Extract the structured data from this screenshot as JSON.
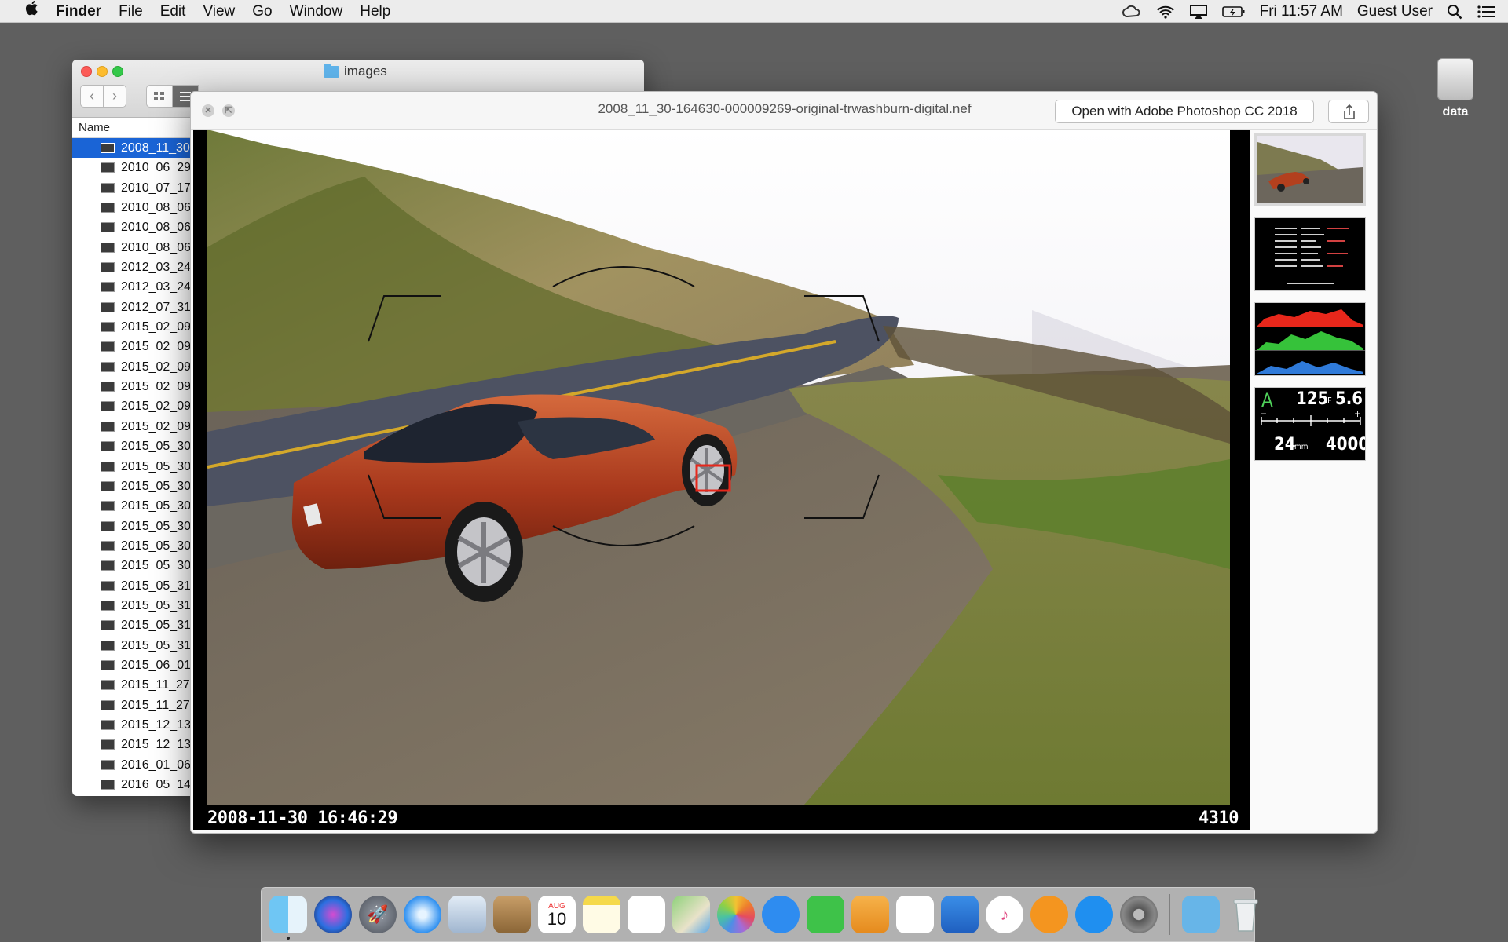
{
  "menubar": {
    "apple": "",
    "app_name": "Finder",
    "menus": [
      "File",
      "Edit",
      "View",
      "Go",
      "Window",
      "Help"
    ],
    "clock": "Fri 11:57 AM",
    "user": "Guest User"
  },
  "desktop": {
    "drive_label": "data"
  },
  "finder": {
    "title": "images",
    "column_header": "Name",
    "files": [
      "2008_11_30",
      "2010_06_29",
      "2010_07_17-",
      "2010_08_06",
      "2010_08_06",
      "2010_08_06",
      "2012_03_24",
      "2012_03_24",
      "2012_07_31-",
      "2015_02_09",
      "2015_02_09",
      "2015_02_09",
      "2015_02_09",
      "2015_02_09",
      "2015_02_09",
      "2015_05_30",
      "2015_05_30",
      "2015_05_30",
      "2015_05_30",
      "2015_05_30",
      "2015_05_30",
      "2015_05_30",
      "2015_05_31",
      "2015_05_31",
      "2015_05_31",
      "2015_05_31",
      "2015_06_01",
      "2015_11_27-",
      "2015_11_27-",
      "2015_12_13-",
      "2015_12_13-",
      "2016_01_06",
      "2016_05_14"
    ],
    "selected_index": 0
  },
  "quicklook": {
    "filename": "2008_11_30-164630-000009269-original-trwashburn-digital.nef",
    "open_with_label": "Open with Adobe Photoshop CC 2018",
    "timestamp": "2008-11-30 16:46:29",
    "frame_number": "4310",
    "dial": {
      "mode": "A",
      "shutter": "125",
      "aperture_prefix": "F",
      "aperture": "5.6",
      "focal": "24",
      "focal_unit": "mm",
      "iso": "4000",
      "minus": "−",
      "plus": "+"
    }
  },
  "colors": {
    "selection": "#1a64d6",
    "focus_box": "#e8271b",
    "close": "#fc5b57",
    "minimize": "#fdbc2e",
    "zoom": "#34c84a"
  },
  "dock": {
    "icons": [
      "finder-icon",
      "siri-icon",
      "launchpad-icon",
      "safari-icon",
      "mail-icon",
      "contacts-icon",
      "calendar-icon",
      "notes-icon",
      "reminders-icon",
      "maps-icon",
      "photos-icon",
      "messages-icon",
      "facetime-icon",
      "pages-icon",
      "numbers-icon",
      "keynote-icon",
      "itunes-icon",
      "ibooks-icon",
      "app-store-icon",
      "system-preferences-icon",
      "downloads-folder-icon",
      "trash-icon"
    ],
    "calendar_month": "AUG",
    "calendar_day": "10"
  }
}
